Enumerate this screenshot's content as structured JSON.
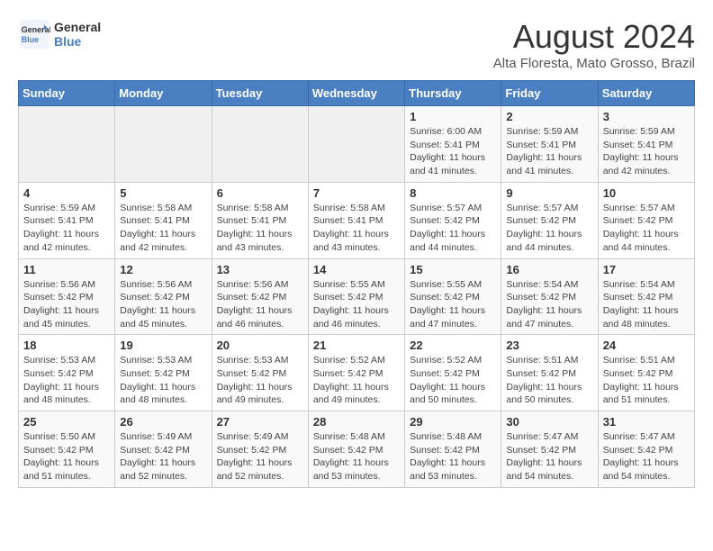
{
  "header": {
    "logo_line1": "General",
    "logo_line2": "Blue",
    "title": "August 2024",
    "subtitle": "Alta Floresta, Mato Grosso, Brazil"
  },
  "weekdays": [
    "Sunday",
    "Monday",
    "Tuesday",
    "Wednesday",
    "Thursday",
    "Friday",
    "Saturday"
  ],
  "weeks": [
    [
      {
        "day": "",
        "info": ""
      },
      {
        "day": "",
        "info": ""
      },
      {
        "day": "",
        "info": ""
      },
      {
        "day": "",
        "info": ""
      },
      {
        "day": "1",
        "info": "Sunrise: 6:00 AM\nSunset: 5:41 PM\nDaylight: 11 hours\nand 41 minutes."
      },
      {
        "day": "2",
        "info": "Sunrise: 5:59 AM\nSunset: 5:41 PM\nDaylight: 11 hours\nand 41 minutes."
      },
      {
        "day": "3",
        "info": "Sunrise: 5:59 AM\nSunset: 5:41 PM\nDaylight: 11 hours\nand 42 minutes."
      }
    ],
    [
      {
        "day": "4",
        "info": "Sunrise: 5:59 AM\nSunset: 5:41 PM\nDaylight: 11 hours\nand 42 minutes."
      },
      {
        "day": "5",
        "info": "Sunrise: 5:58 AM\nSunset: 5:41 PM\nDaylight: 11 hours\nand 42 minutes."
      },
      {
        "day": "6",
        "info": "Sunrise: 5:58 AM\nSunset: 5:41 PM\nDaylight: 11 hours\nand 43 minutes."
      },
      {
        "day": "7",
        "info": "Sunrise: 5:58 AM\nSunset: 5:41 PM\nDaylight: 11 hours\nand 43 minutes."
      },
      {
        "day": "8",
        "info": "Sunrise: 5:57 AM\nSunset: 5:42 PM\nDaylight: 11 hours\nand 44 minutes."
      },
      {
        "day": "9",
        "info": "Sunrise: 5:57 AM\nSunset: 5:42 PM\nDaylight: 11 hours\nand 44 minutes."
      },
      {
        "day": "10",
        "info": "Sunrise: 5:57 AM\nSunset: 5:42 PM\nDaylight: 11 hours\nand 44 minutes."
      }
    ],
    [
      {
        "day": "11",
        "info": "Sunrise: 5:56 AM\nSunset: 5:42 PM\nDaylight: 11 hours\nand 45 minutes."
      },
      {
        "day": "12",
        "info": "Sunrise: 5:56 AM\nSunset: 5:42 PM\nDaylight: 11 hours\nand 45 minutes."
      },
      {
        "day": "13",
        "info": "Sunrise: 5:56 AM\nSunset: 5:42 PM\nDaylight: 11 hours\nand 46 minutes."
      },
      {
        "day": "14",
        "info": "Sunrise: 5:55 AM\nSunset: 5:42 PM\nDaylight: 11 hours\nand 46 minutes."
      },
      {
        "day": "15",
        "info": "Sunrise: 5:55 AM\nSunset: 5:42 PM\nDaylight: 11 hours\nand 47 minutes."
      },
      {
        "day": "16",
        "info": "Sunrise: 5:54 AM\nSunset: 5:42 PM\nDaylight: 11 hours\nand 47 minutes."
      },
      {
        "day": "17",
        "info": "Sunrise: 5:54 AM\nSunset: 5:42 PM\nDaylight: 11 hours\nand 48 minutes."
      }
    ],
    [
      {
        "day": "18",
        "info": "Sunrise: 5:53 AM\nSunset: 5:42 PM\nDaylight: 11 hours\nand 48 minutes."
      },
      {
        "day": "19",
        "info": "Sunrise: 5:53 AM\nSunset: 5:42 PM\nDaylight: 11 hours\nand 48 minutes."
      },
      {
        "day": "20",
        "info": "Sunrise: 5:53 AM\nSunset: 5:42 PM\nDaylight: 11 hours\nand 49 minutes."
      },
      {
        "day": "21",
        "info": "Sunrise: 5:52 AM\nSunset: 5:42 PM\nDaylight: 11 hours\nand 49 minutes."
      },
      {
        "day": "22",
        "info": "Sunrise: 5:52 AM\nSunset: 5:42 PM\nDaylight: 11 hours\nand 50 minutes."
      },
      {
        "day": "23",
        "info": "Sunrise: 5:51 AM\nSunset: 5:42 PM\nDaylight: 11 hours\nand 50 minutes."
      },
      {
        "day": "24",
        "info": "Sunrise: 5:51 AM\nSunset: 5:42 PM\nDaylight: 11 hours\nand 51 minutes."
      }
    ],
    [
      {
        "day": "25",
        "info": "Sunrise: 5:50 AM\nSunset: 5:42 PM\nDaylight: 11 hours\nand 51 minutes."
      },
      {
        "day": "26",
        "info": "Sunrise: 5:49 AM\nSunset: 5:42 PM\nDaylight: 11 hours\nand 52 minutes."
      },
      {
        "day": "27",
        "info": "Sunrise: 5:49 AM\nSunset: 5:42 PM\nDaylight: 11 hours\nand 52 minutes."
      },
      {
        "day": "28",
        "info": "Sunrise: 5:48 AM\nSunset: 5:42 PM\nDaylight: 11 hours\nand 53 minutes."
      },
      {
        "day": "29",
        "info": "Sunrise: 5:48 AM\nSunset: 5:42 PM\nDaylight: 11 hours\nand 53 minutes."
      },
      {
        "day": "30",
        "info": "Sunrise: 5:47 AM\nSunset: 5:42 PM\nDaylight: 11 hours\nand 54 minutes."
      },
      {
        "day": "31",
        "info": "Sunrise: 5:47 AM\nSunset: 5:42 PM\nDaylight: 11 hours\nand 54 minutes."
      }
    ]
  ]
}
